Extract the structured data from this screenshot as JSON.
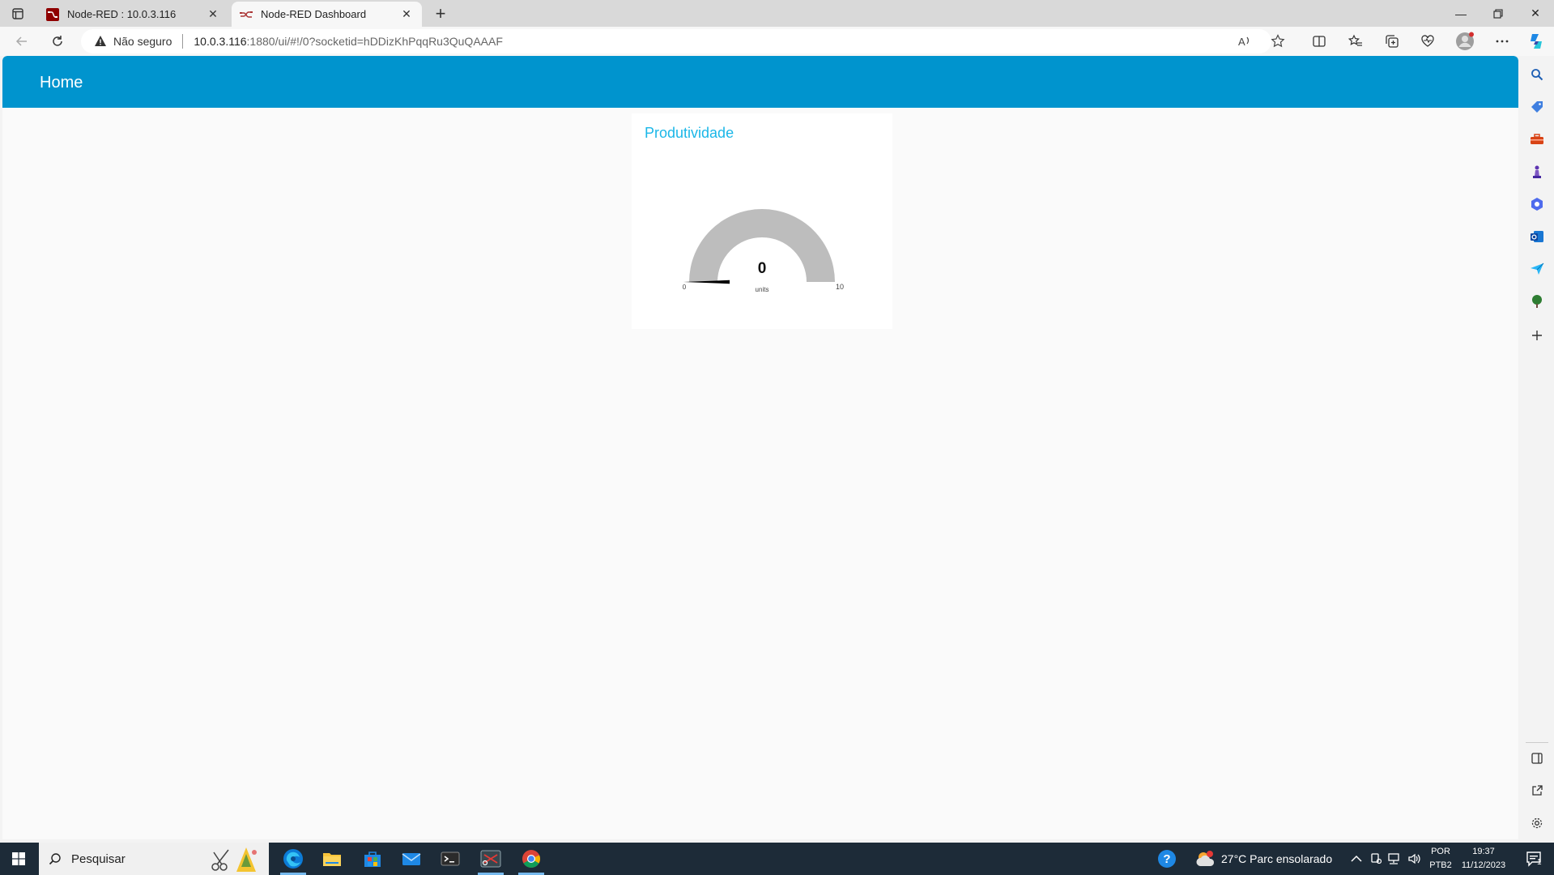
{
  "browser": {
    "tabs": [
      {
        "title": "Node-RED : 10.0.3.116",
        "active": false
      },
      {
        "title": "Node-RED Dashboard",
        "active": true
      }
    ],
    "address": {
      "security_label": "Não seguro",
      "host": "10.0.3.116",
      "rest": ":1880/ui/#!/0?socketid=hDDizKhPqqRu3QuQAAAF"
    }
  },
  "dashboard": {
    "header_title": "Home",
    "card_title": "Produtividade",
    "gauge": {
      "value": 0,
      "display_value": "0",
      "units": "units",
      "min": 0,
      "max": 10,
      "min_label": "0",
      "max_label": "10",
      "track_color": "#bdbdbd",
      "needle_color": "#000000"
    }
  },
  "colors": {
    "header": "#0094ce",
    "card_title": "#1bb7e8",
    "taskbar": "#1d2b38"
  },
  "taskbar": {
    "search_placeholder": "Pesquisar",
    "weather": "27°C  Parc ensolarado",
    "language_top": "POR",
    "language_bottom": "PTB2",
    "time": "19:37",
    "date": "11/12/2023",
    "notification_count": "1"
  }
}
